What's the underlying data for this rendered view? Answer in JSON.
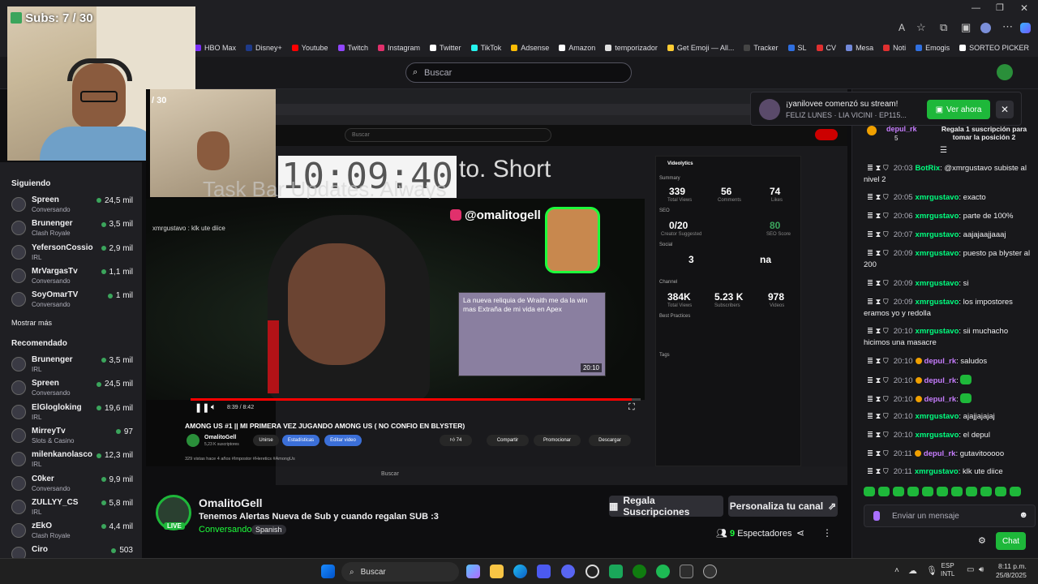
{
  "overlay": {
    "subs": "Subs: 7 / 30",
    "subs_inner": "/ 30"
  },
  "bookmarks": [
    {
      "label": "HBO Max",
      "color": "#7b2ff7"
    },
    {
      "label": "Disney+",
      "color": "#1e3a8a"
    },
    {
      "label": "Youtube",
      "color": "#ff0000"
    },
    {
      "label": "Twitch",
      "color": "#9146ff"
    },
    {
      "label": "Instagram",
      "color": "#e1306c"
    },
    {
      "label": "Twitter",
      "color": "#ffffff"
    },
    {
      "label": "TikTok",
      "color": "#25f4ee"
    },
    {
      "label": "Adsense",
      "color": "#fbbc04"
    },
    {
      "label": "Amazon",
      "color": "#ffffff"
    },
    {
      "label": "temporizador",
      "color": "#e0e0e0"
    },
    {
      "label": "Get Emoji — All...",
      "color": "#ffcc33"
    },
    {
      "label": "Tracker",
      "color": "#444"
    },
    {
      "label": "SL",
      "color": "#2f6fe0"
    },
    {
      "label": "CV",
      "color": "#e03030"
    },
    {
      "label": "Mesa",
      "color": "#7289da"
    },
    {
      "label": "Noti",
      "color": "#e03030"
    },
    {
      "label": "Emogis",
      "color": "#3070e0"
    },
    {
      "label": "SORTEO PICKER",
      "color": "#ffffff"
    }
  ],
  "search": {
    "placeholder": "Buscar"
  },
  "sidebar": {
    "following_title": "Siguiendo",
    "show_more": "Mostrar más",
    "recommended_title": "Recomendado",
    "following": [
      {
        "name": "Spreen",
        "game": "Conversando",
        "viewers": "24,5 mil"
      },
      {
        "name": "Brunenger",
        "game": "Clash Royale",
        "viewers": "3,5 mil"
      },
      {
        "name": "YefersonCossio",
        "game": "IRL",
        "viewers": "2,9 mil"
      },
      {
        "name": "MrVargasTv",
        "game": "Conversando",
        "viewers": "1,1 mil"
      },
      {
        "name": "SoyOmarTV",
        "game": "Conversando",
        "viewers": "1 mil"
      }
    ],
    "recommended": [
      {
        "name": "Brunenger",
        "game": "IRL",
        "viewers": "3,5 mil"
      },
      {
        "name": "Spreen",
        "game": "Conversando",
        "viewers": "24,5 mil"
      },
      {
        "name": "ElGlogloking",
        "game": "IRL",
        "viewers": "19,6 mil"
      },
      {
        "name": "MirreyTv",
        "game": "Slots & Casino",
        "viewers": "97"
      },
      {
        "name": "milenkanolasco",
        "game": "IRL",
        "viewers": "12,3 mil"
      },
      {
        "name": "C0ker",
        "game": "Conversando",
        "viewers": "9,9 mil"
      },
      {
        "name": "ZULLYY_CS",
        "game": "IRL",
        "viewers": "5,8 mil"
      },
      {
        "name": "zEkO",
        "game": "Clash Royale",
        "viewers": "4,4 mil"
      },
      {
        "name": "Ciro",
        "game": "",
        "viewers": "503"
      }
    ]
  },
  "video": {
    "clock": "10:09:40",
    "headline": "to. Short",
    "headline2": "Task Bar Updates. Always",
    "insta": "@omalitogell",
    "chat_line": "xmrgustavo : klk ute diice",
    "card_text": "La nueva reliquia de Wraith me da la win mas Extraña de mi vida en Apex",
    "card_time": "20:10",
    "inner_time": "8:39 / 8:42",
    "yt_title": "AMONG US #1 || MI PRIMERA VEZ JUGANDO AMONG US ( NO CONFIO EN BLYSTER)",
    "yt_channel": "OmalitoGell",
    "yt_subs": "5,23 K suscriptores",
    "yt_buttons": [
      "Unirse",
      "Estadísticas",
      "Editar video"
    ],
    "yt_actions": [
      "74",
      "Compartir",
      "Promocionar",
      "Descargar"
    ],
    "yt_meta": "329 vistas  hace 4 años  #Impostor #Heretics #AmongUs",
    "vidiq": {
      "title": "VideoIytics",
      "summary": "Summary",
      "views": "339",
      "views_l": "Total Views",
      "comments": "56",
      "comments_l": "Comments",
      "likes": "74",
      "likes_l": "Likes",
      "seo": "SEO",
      "seo_score": "0/20",
      "seo_score_l": "Creator Suggested",
      "seo_val": "80",
      "seo_val_l": "SEO Score",
      "social": "Social",
      "soc1": "3",
      "soc2": "na",
      "channel": "Channel",
      "c1": "384K",
      "c2": "5.23 K",
      "c3": "978",
      "c1l": "Total Views",
      "c2l": "Subscribers",
      "c3l": "Videos",
      "best": "Best Practices",
      "tags": "Tags"
    }
  },
  "notification": {
    "user": "¡yanilovee comenzó su stream!",
    "sub": "FELIZ LUNES  ·  LIA VICINI  ·  EP115...",
    "button": "Ver ahora"
  },
  "gift": {
    "user": "depul_rk",
    "count": "5",
    "text": "Regala 1 suscripción para tomar la posición 2"
  },
  "chat": {
    "messages": [
      {
        "time": "20:03",
        "user": "BotRix",
        "color": "#00ff7f",
        "text": ": @xmrgustavo subiste al nivel 2"
      },
      {
        "time": "20:05",
        "user": "xmrgustavo",
        "color": "#00ff7f",
        "text": ": exacto"
      },
      {
        "time": "20:06",
        "user": "xmrgustavo",
        "color": "#00ff7f",
        "text": ": parte de 100%"
      },
      {
        "time": "20:07",
        "user": "xmrgustavo",
        "color": "#00ff7f",
        "text": ": aajajaajjaaaj"
      },
      {
        "time": "20:09",
        "user": "xmrgustavo",
        "color": "#00ff7f",
        "text": ": puesto pa blyster al 200"
      },
      {
        "time": "20:09",
        "user": "xmrgustavo",
        "color": "#00ff7f",
        "text": ": si"
      },
      {
        "time": "20:09",
        "user": "xmrgustavo",
        "color": "#00ff7f",
        "text": ": los impostores eramos yo y redolla"
      },
      {
        "time": "20:10",
        "user": "xmrgustavo",
        "color": "#00ff7f",
        "text": ": sii muchacho hicimos una masacre"
      },
      {
        "time": "20:10",
        "user": "depul_rk",
        "color": "#c77dff",
        "text": ": saludos"
      },
      {
        "time": "20:10",
        "user": "depul_rk",
        "color": "#c77dff",
        "text": ": "
      },
      {
        "time": "20:10",
        "user": "depul_rk",
        "color": "#c77dff",
        "text": ": "
      },
      {
        "time": "20:10",
        "user": "xmrgustavo",
        "color": "#00ff7f",
        "text": ": ajajjajajaj"
      },
      {
        "time": "20:10",
        "user": "xmrgustavo",
        "color": "#00ff7f",
        "text": ": el depul"
      },
      {
        "time": "20:11",
        "user": "depul_rk",
        "color": "#c77dff",
        "text": ": gutavitooooo"
      },
      {
        "time": "20:11",
        "user": "xmrgustavo",
        "color": "#00ff7f",
        "text": ": klk ute diice"
      }
    ],
    "input_placeholder": "Enviar un mensaje",
    "send": "Chat"
  },
  "stream": {
    "name": "OmalitoGell",
    "title": "Tenemos Alertas Nueva de Sub y cuando regalan SUB :3",
    "category": "Conversando",
    "tag": "Spanish",
    "live": "LIVE",
    "gift_btn": "Regala Suscripciones",
    "customize_btn": "Personaliza tu canal",
    "viewers": "9",
    "viewers_label": "Espectadores"
  },
  "taskbar": {
    "search": "Buscar",
    "lang": "ESP",
    "lang2": "INTL",
    "time": "8:11 p.m.",
    "date": "25/8/2025"
  }
}
